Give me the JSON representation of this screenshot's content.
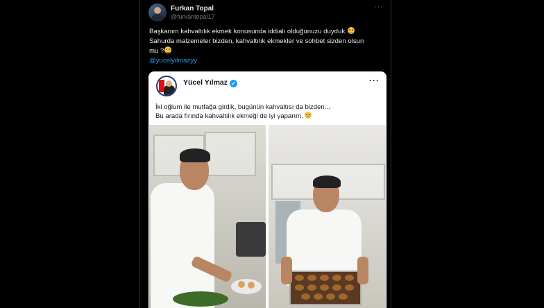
{
  "tweet": {
    "author_name": "Furkan Topal",
    "author_handle": "@furkantopal17",
    "more_label": "···",
    "text_lines": [
      "Başkanım kahvaltılık ekmek konusunda iddialı olduğunuzu duyduk.",
      "Sahurda malzemeler bizden, kahvaltılık ekmekler ve sohbet sizden olsun",
      "mu ?"
    ],
    "mention": "@yucelyilmazyy"
  },
  "quoted": {
    "author_name": "Yücel Yılmaz",
    "verified_mark": "✓",
    "more_label": "···",
    "text_lines": [
      "İki oğlum ile mutfağa girdik, bugünün kahvaltısı da bizden...",
      "Bu arada fırında kahvaltılık ekmeği de iyi yaparım."
    ],
    "photos": [
      "kitchen-photo-left",
      "kitchen-photo-right"
    ]
  },
  "icons": {
    "avatar": "avatar-icon",
    "verified": "verified-badge-icon",
    "smile": "smiling-face-icon",
    "wink": "winking-face-icon",
    "more": "more-options-icon"
  },
  "colors": {
    "background": "#000000",
    "text_primary": "#e7e9ea",
    "text_secondary": "#71767b",
    "link": "#1d9bf0",
    "card_background": "#ffffff",
    "card_text": "#0f1419"
  }
}
